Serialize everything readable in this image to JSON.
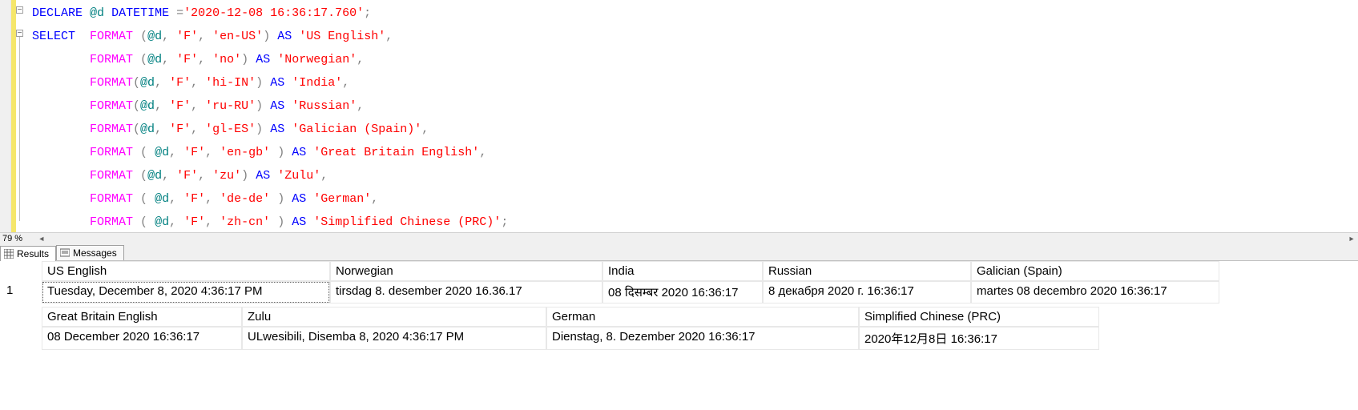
{
  "editor": {
    "zoom": "79 %",
    "lines": [
      [
        {
          "t": "DECLARE",
          "c": "kw"
        },
        {
          "t": " "
        },
        {
          "t": "@d",
          "c": "var"
        },
        {
          "t": " "
        },
        {
          "t": "DATETIME",
          "c": "kw"
        },
        {
          "t": " "
        },
        {
          "t": "=",
          "c": "gray"
        },
        {
          "t": "'2020-12-08 16:36:17.760'",
          "c": "str"
        },
        {
          "t": ";",
          "c": "gray"
        }
      ],
      [
        {
          "t": "SELECT",
          "c": "kw"
        },
        {
          "t": "  "
        },
        {
          "t": "FORMAT",
          "c": "func"
        },
        {
          "t": " ",
          "c": "gray"
        },
        {
          "t": "(",
          "c": "gray"
        },
        {
          "t": "@d",
          "c": "var"
        },
        {
          "t": ",",
          "c": "gray"
        },
        {
          "t": " "
        },
        {
          "t": "'F'",
          "c": "str"
        },
        {
          "t": ",",
          "c": "gray"
        },
        {
          "t": " "
        },
        {
          "t": "'en-US'",
          "c": "str"
        },
        {
          "t": ")",
          "c": "gray"
        },
        {
          "t": " "
        },
        {
          "t": "AS",
          "c": "kw"
        },
        {
          "t": " "
        },
        {
          "t": "'US English'",
          "c": "str"
        },
        {
          "t": ",",
          "c": "gray"
        }
      ],
      [
        {
          "t": "        "
        },
        {
          "t": "FORMAT",
          "c": "func"
        },
        {
          "t": " ",
          "c": "gray"
        },
        {
          "t": "(",
          "c": "gray"
        },
        {
          "t": "@d",
          "c": "var"
        },
        {
          "t": ",",
          "c": "gray"
        },
        {
          "t": " "
        },
        {
          "t": "'F'",
          "c": "str"
        },
        {
          "t": ",",
          "c": "gray"
        },
        {
          "t": " "
        },
        {
          "t": "'no'",
          "c": "str"
        },
        {
          "t": ")",
          "c": "gray"
        },
        {
          "t": " "
        },
        {
          "t": "AS",
          "c": "kw"
        },
        {
          "t": " "
        },
        {
          "t": "'Norwegian'",
          "c": "str"
        },
        {
          "t": ",",
          "c": "gray"
        }
      ],
      [
        {
          "t": "        "
        },
        {
          "t": "FORMAT",
          "c": "func"
        },
        {
          "t": "(",
          "c": "gray"
        },
        {
          "t": "@d",
          "c": "var"
        },
        {
          "t": ",",
          "c": "gray"
        },
        {
          "t": " "
        },
        {
          "t": "'F'",
          "c": "str"
        },
        {
          "t": ",",
          "c": "gray"
        },
        {
          "t": " "
        },
        {
          "t": "'hi-IN'",
          "c": "str"
        },
        {
          "t": ")",
          "c": "gray"
        },
        {
          "t": " "
        },
        {
          "t": "AS",
          "c": "kw"
        },
        {
          "t": " "
        },
        {
          "t": "'India'",
          "c": "str"
        },
        {
          "t": ",",
          "c": "gray"
        }
      ],
      [
        {
          "t": "        "
        },
        {
          "t": "FORMAT",
          "c": "func"
        },
        {
          "t": "(",
          "c": "gray"
        },
        {
          "t": "@d",
          "c": "var"
        },
        {
          "t": ",",
          "c": "gray"
        },
        {
          "t": " "
        },
        {
          "t": "'F'",
          "c": "str"
        },
        {
          "t": ",",
          "c": "gray"
        },
        {
          "t": " "
        },
        {
          "t": "'ru-RU'",
          "c": "str"
        },
        {
          "t": ")",
          "c": "gray"
        },
        {
          "t": " "
        },
        {
          "t": "AS",
          "c": "kw"
        },
        {
          "t": " "
        },
        {
          "t": "'Russian'",
          "c": "str"
        },
        {
          "t": ",",
          "c": "gray"
        }
      ],
      [
        {
          "t": "        "
        },
        {
          "t": "FORMAT",
          "c": "func"
        },
        {
          "t": "(",
          "c": "gray"
        },
        {
          "t": "@d",
          "c": "var"
        },
        {
          "t": ",",
          "c": "gray"
        },
        {
          "t": " "
        },
        {
          "t": "'F'",
          "c": "str"
        },
        {
          "t": ",",
          "c": "gray"
        },
        {
          "t": " "
        },
        {
          "t": "'gl-ES'",
          "c": "str"
        },
        {
          "t": ")",
          "c": "gray"
        },
        {
          "t": " "
        },
        {
          "t": "AS",
          "c": "kw"
        },
        {
          "t": " "
        },
        {
          "t": "'Galician (Spain)'",
          "c": "str"
        },
        {
          "t": ",",
          "c": "gray"
        }
      ],
      [
        {
          "t": "        "
        },
        {
          "t": "FORMAT",
          "c": "func"
        },
        {
          "t": " ",
          "c": "gray"
        },
        {
          "t": "(",
          "c": "gray"
        },
        {
          "t": " "
        },
        {
          "t": "@d",
          "c": "var"
        },
        {
          "t": ",",
          "c": "gray"
        },
        {
          "t": " "
        },
        {
          "t": "'F'",
          "c": "str"
        },
        {
          "t": ",",
          "c": "gray"
        },
        {
          "t": " "
        },
        {
          "t": "'en-gb'",
          "c": "str"
        },
        {
          "t": " "
        },
        {
          "t": ")",
          "c": "gray"
        },
        {
          "t": " "
        },
        {
          "t": "AS",
          "c": "kw"
        },
        {
          "t": " "
        },
        {
          "t": "'Great Britain English'",
          "c": "str"
        },
        {
          "t": ",",
          "c": "gray"
        }
      ],
      [
        {
          "t": "        "
        },
        {
          "t": "FORMAT",
          "c": "func"
        },
        {
          "t": " ",
          "c": "gray"
        },
        {
          "t": "(",
          "c": "gray"
        },
        {
          "t": "@d",
          "c": "var"
        },
        {
          "t": ",",
          "c": "gray"
        },
        {
          "t": " "
        },
        {
          "t": "'F'",
          "c": "str"
        },
        {
          "t": ",",
          "c": "gray"
        },
        {
          "t": " "
        },
        {
          "t": "'zu'",
          "c": "str"
        },
        {
          "t": ")",
          "c": "gray"
        },
        {
          "t": " "
        },
        {
          "t": "AS",
          "c": "kw"
        },
        {
          "t": " "
        },
        {
          "t": "'Zulu'",
          "c": "str"
        },
        {
          "t": ",",
          "c": "gray"
        }
      ],
      [
        {
          "t": "        "
        },
        {
          "t": "FORMAT",
          "c": "func"
        },
        {
          "t": " ",
          "c": "gray"
        },
        {
          "t": "(",
          "c": "gray"
        },
        {
          "t": " "
        },
        {
          "t": "@d",
          "c": "var"
        },
        {
          "t": ",",
          "c": "gray"
        },
        {
          "t": " "
        },
        {
          "t": "'F'",
          "c": "str"
        },
        {
          "t": ",",
          "c": "gray"
        },
        {
          "t": " "
        },
        {
          "t": "'de-de'",
          "c": "str"
        },
        {
          "t": " "
        },
        {
          "t": ")",
          "c": "gray"
        },
        {
          "t": " "
        },
        {
          "t": "AS",
          "c": "kw"
        },
        {
          "t": " "
        },
        {
          "t": "'German'",
          "c": "str"
        },
        {
          "t": ",",
          "c": "gray"
        }
      ],
      [
        {
          "t": "        "
        },
        {
          "t": "FORMAT",
          "c": "func"
        },
        {
          "t": " ",
          "c": "gray"
        },
        {
          "t": "(",
          "c": "gray"
        },
        {
          "t": " "
        },
        {
          "t": "@d",
          "c": "var"
        },
        {
          "t": ",",
          "c": "gray"
        },
        {
          "t": " "
        },
        {
          "t": "'F'",
          "c": "str"
        },
        {
          "t": ",",
          "c": "gray"
        },
        {
          "t": " "
        },
        {
          "t": "'zh-cn'",
          "c": "str"
        },
        {
          "t": " "
        },
        {
          "t": ")",
          "c": "gray"
        },
        {
          "t": " "
        },
        {
          "t": "AS",
          "c": "kw"
        },
        {
          "t": " "
        },
        {
          "t": "'Simplified Chinese (PRC)'",
          "c": "str"
        },
        {
          "t": ";",
          "c": "gray"
        }
      ]
    ]
  },
  "tabs": {
    "results": "Results",
    "messages": "Messages"
  },
  "results": {
    "row1": {
      "num": "1",
      "headers": [
        "US English",
        "Norwegian",
        "India",
        "Russian",
        "Galician (Spain)"
      ],
      "values": [
        "Tuesday, December 8, 2020 4:36:17 PM",
        "tirsdag 8. desember 2020 16.36.17",
        "08 दिसम्बर 2020 16:36:17",
        "8 декабря 2020 г. 16:36:17",
        "martes 08 decembro 2020 16:36:17"
      ],
      "widths": [
        360,
        340,
        200,
        260,
        310
      ]
    },
    "row2": {
      "headers": [
        "Great Britain English",
        "Zulu",
        "German",
        "Simplified Chinese (PRC)"
      ],
      "values": [
        "08 December 2020 16:36:17",
        "ULwesibili, Disemba 8, 2020 4:36:17 PM",
        "Dienstag, 8. Dezember 2020 16:36:17",
        "2020年12月8日 16:36:17"
      ],
      "widths": [
        250,
        380,
        390,
        300
      ]
    }
  }
}
